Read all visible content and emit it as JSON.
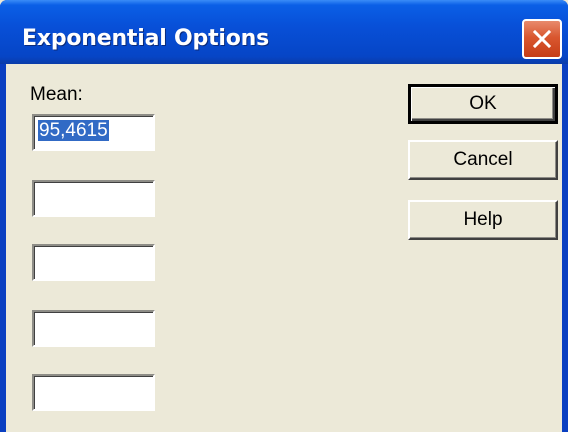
{
  "window": {
    "title": "Exponential Options"
  },
  "form": {
    "mean_label": "Mean:",
    "mean_value": "95,4615",
    "extra_fields": [
      "",
      "",
      "",
      ""
    ]
  },
  "buttons": {
    "ok": "OK",
    "cancel": "Cancel",
    "help": "Help"
  },
  "icons": {
    "close": "close-icon"
  },
  "colors": {
    "titlebar": "#0850d8",
    "close_button": "#d9572f",
    "dialog_background": "#ece9d8",
    "selection": "#316ac5"
  }
}
